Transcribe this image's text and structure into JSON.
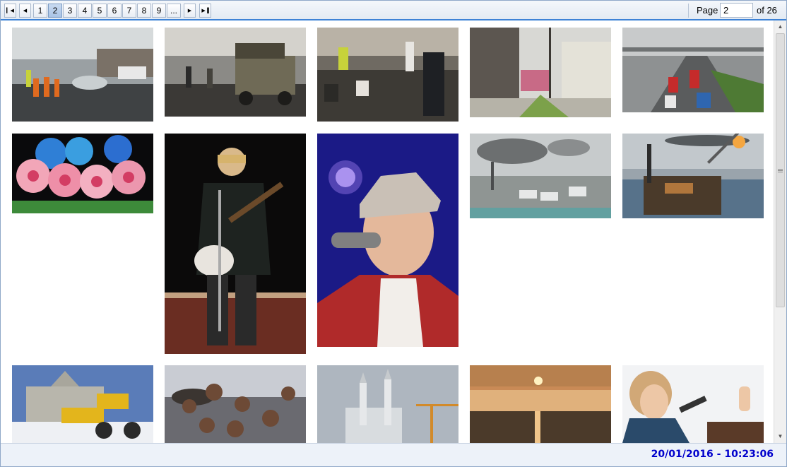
{
  "pager": {
    "first_icon": "first-page-icon",
    "prev_icon": "previous-page-icon",
    "next_icon": "next-page-icon",
    "last_icon": "last-page-icon",
    "pages": [
      "1",
      "2",
      "3",
      "4",
      "5",
      "6",
      "7",
      "8",
      "9",
      "..."
    ],
    "current_page": "2",
    "page_label": "Page",
    "page_input_value": "2",
    "of_label": "of 26"
  },
  "gallery": {
    "thumbnails": [
      "street-cleanup-workers-photo",
      "military-truck-street-photo",
      "street-inspection-photo",
      "town-street-wall-photo",
      "highway-traffic-jam-photo",
      "flower-costume-dancers-photo",
      "singer-with-guitar-photo",
      "singer-with-microphone-photo",
      "industrial-refinery-photo",
      "offshore-oil-platform-photo",
      "snowy-parliament-excavator-photo",
      "monkeys-in-snow-photo",
      "castle-under-construction-photo",
      "sunrise-over-reeds-photo",
      "woman-speaking-at-podium-photo"
    ]
  },
  "scrollbar": {
    "up_icon": "scroll-up-icon",
    "down_icon": "scroll-down-icon",
    "position": 0
  },
  "status": {
    "datetime": "20/01/2016 - 10:23:06"
  }
}
